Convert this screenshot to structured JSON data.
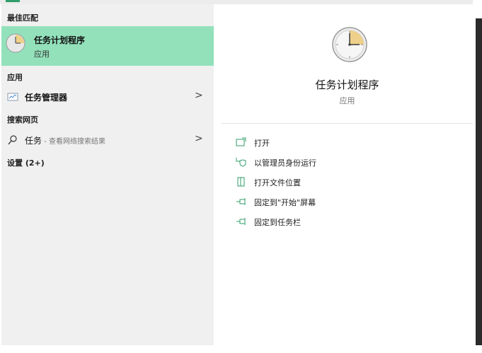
{
  "left": {
    "best_match_header": "最佳匹配",
    "best_match": {
      "title": "任务计划程序",
      "subtitle": "应用"
    },
    "apps_header": "应用",
    "apps": [
      {
        "label": "任务管理器",
        "chevron": ">"
      }
    ],
    "web_header": "搜索网页",
    "web": {
      "label": "任务",
      "suffix": " - 查看网络搜索结果",
      "chevron": ">"
    },
    "settings_header": "设置 (2+)"
  },
  "right": {
    "title": "任务计划程序",
    "subtitle": "应用",
    "actions": [
      {
        "label": "打开",
        "icon": "open-icon"
      },
      {
        "label": "以管理员身份运行",
        "icon": "admin-shield-icon"
      },
      {
        "label": "打开文件位置",
        "icon": "file-location-icon"
      },
      {
        "label": "固定到\"开始\"屏幕",
        "icon": "pin-icon"
      },
      {
        "label": "固定到任务栏",
        "icon": "pin-icon"
      }
    ]
  },
  "colors": {
    "highlight": "#93e1bb",
    "accent": "#2f9e6a",
    "panel": "#f0f0f0"
  }
}
